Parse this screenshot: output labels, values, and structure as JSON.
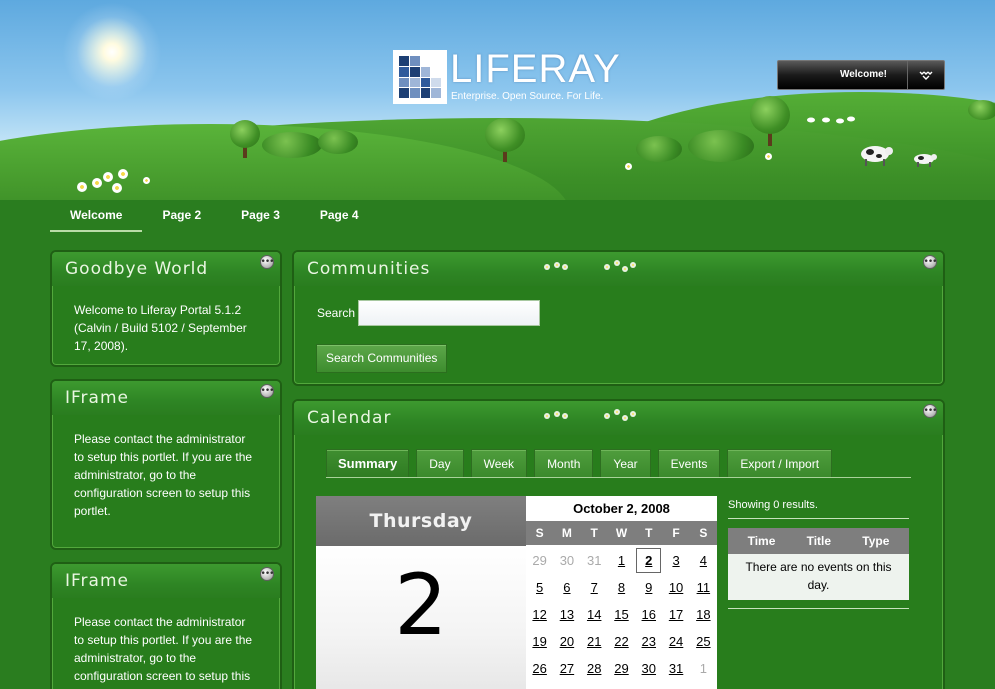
{
  "header": {
    "logo_name": "LIFERAY",
    "logo_tagline": "Enterprise. Open Source. For Life.",
    "welcome_label": "Welcome!"
  },
  "nav": {
    "items": [
      {
        "label": "Welcome",
        "selected": true
      },
      {
        "label": "Page 2"
      },
      {
        "label": "Page 3"
      },
      {
        "label": "Page 4"
      }
    ]
  },
  "portlets": {
    "goodbye": {
      "title": "Goodbye World",
      "body": "Welcome to Liferay Portal 5.1.2 (Calvin / Build 5102 / September 17, 2008)."
    },
    "iframe1": {
      "title": "IFrame",
      "body": "Please contact the administrator to setup this portlet. If you are the administrator, go to the configuration screen to setup this portlet."
    },
    "iframe2": {
      "title": "IFrame",
      "body": "Please contact the administrator to setup this portlet. If you are the administrator, go to the configuration screen to setup this portlet."
    },
    "communities": {
      "title": "Communities",
      "search_label": "Search",
      "search_value": "",
      "search_button": "Search Communities"
    },
    "calendar": {
      "title": "Calendar",
      "tabs": [
        "Summary",
        "Day",
        "Week",
        "Month",
        "Year",
        "Events",
        "Export / Import"
      ],
      "active_tab": "Summary",
      "day_name": "Thursday",
      "day_number": "2",
      "month_title": "October 2, 2008",
      "dow": [
        "S",
        "M",
        "T",
        "W",
        "T",
        "F",
        "S"
      ],
      "days": [
        {
          "d": "29",
          "other": true
        },
        {
          "d": "30",
          "other": true
        },
        {
          "d": "31",
          "other": true
        },
        {
          "d": "1"
        },
        {
          "d": "2",
          "today": true
        },
        {
          "d": "3"
        },
        {
          "d": "4"
        },
        {
          "d": "5"
        },
        {
          "d": "6"
        },
        {
          "d": "7"
        },
        {
          "d": "8"
        },
        {
          "d": "9"
        },
        {
          "d": "10"
        },
        {
          "d": "11"
        },
        {
          "d": "12"
        },
        {
          "d": "13"
        },
        {
          "d": "14"
        },
        {
          "d": "15"
        },
        {
          "d": "16"
        },
        {
          "d": "17"
        },
        {
          "d": "18"
        },
        {
          "d": "19"
        },
        {
          "d": "20"
        },
        {
          "d": "21"
        },
        {
          "d": "22"
        },
        {
          "d": "23"
        },
        {
          "d": "24"
        },
        {
          "d": "25"
        },
        {
          "d": "26"
        },
        {
          "d": "27"
        },
        {
          "d": "28"
        },
        {
          "d": "29"
        },
        {
          "d": "30"
        },
        {
          "d": "31"
        },
        {
          "d": "1",
          "other": true
        }
      ],
      "results_text": "Showing 0 results.",
      "columns": [
        "Time",
        "Title",
        "Type"
      ],
      "empty_text": "There are no events on this day."
    }
  },
  "colors": {
    "page_green": "#2a7d1f",
    "header_gray": "#7e7e7e"
  }
}
